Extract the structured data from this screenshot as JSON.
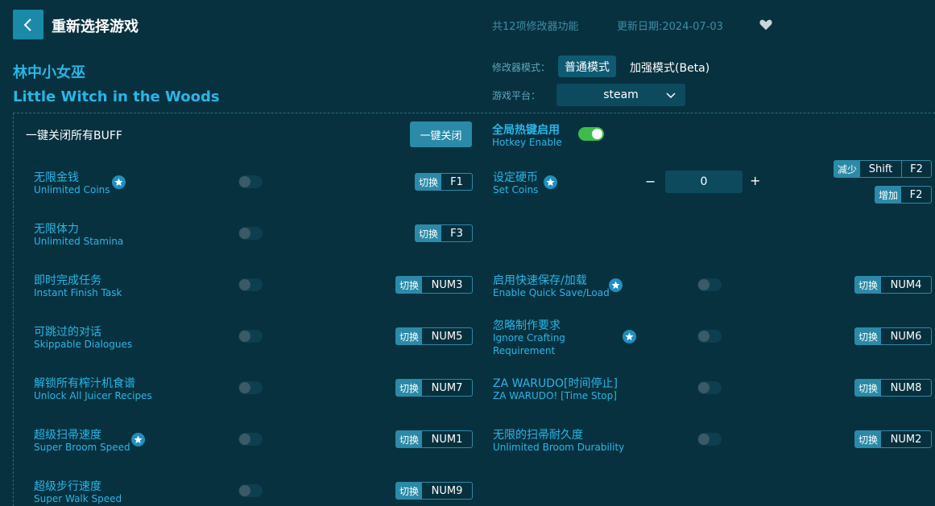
{
  "header": {
    "title": "重新选择游戏",
    "feature_count": "共12项修改器功能",
    "update_date": "更新日期:2024-07-03"
  },
  "game": {
    "name_cn": "林中小女巫",
    "name_en": "Little Witch in the Woods"
  },
  "mode": {
    "label": "修改器模式：",
    "normal": "普通模式",
    "beta": "加强模式(Beta)"
  },
  "platform": {
    "label": "游戏平台：",
    "value": "steam"
  },
  "buff": {
    "label": "一键关闭所有BUFF",
    "button": "一键关闭"
  },
  "hotkey": {
    "label_cn": "全局热键启用",
    "label_en": "Hotkey Enable",
    "enabled": true
  },
  "toggle_label": "切换",
  "set_coins": {
    "name_cn": "设定硬币",
    "name_en": "Set Coins",
    "value": "0",
    "minus": "−",
    "plus": "+",
    "decrease_label": "减少",
    "decrease_mod": "Shift",
    "decrease_key": "F2",
    "increase_label": "增加",
    "increase_key": "F2"
  },
  "options_left": [
    {
      "cn": "无限金钱",
      "en": "Unlimited Coins",
      "star": true,
      "key": "F1"
    },
    {
      "cn": "无限体力",
      "en": "Unlimited Stamina",
      "star": false,
      "key": "F3"
    },
    {
      "cn": "即时完成任务",
      "en": "Instant Finish Task",
      "star": false,
      "key": "NUM3"
    },
    {
      "cn": "可跳过的对话",
      "en": "Skippable Dialogues",
      "star": false,
      "key": "NUM5"
    },
    {
      "cn": "解锁所有榨汁机食谱",
      "en": "Unlock All Juicer Recipes",
      "star": false,
      "key": "NUM7"
    },
    {
      "cn": "超级扫帚速度",
      "en": "Super Broom Speed",
      "star": true,
      "key": "NUM1"
    },
    {
      "cn": "超级步行速度",
      "en": "Super Walk Speed",
      "star": false,
      "key": "NUM9"
    }
  ],
  "options_right": [
    {
      "cn": "启用快速保存/加载",
      "en": "Enable Quick Save/Load",
      "star": true,
      "key": "NUM4"
    },
    {
      "cn": "忽略制作要求",
      "en": "Ignore Crafting",
      "en2": "Requirement",
      "star": true,
      "key": "NUM6"
    },
    {
      "cn": "ZA WARUDO[时间停止]",
      "en": "ZA WARUDO! [Time Stop]",
      "star": false,
      "key": "NUM8"
    },
    {
      "cn": "无限的扫帚耐久度",
      "en": "Unlimited Broom Durability",
      "star": false,
      "key": "NUM2"
    }
  ]
}
